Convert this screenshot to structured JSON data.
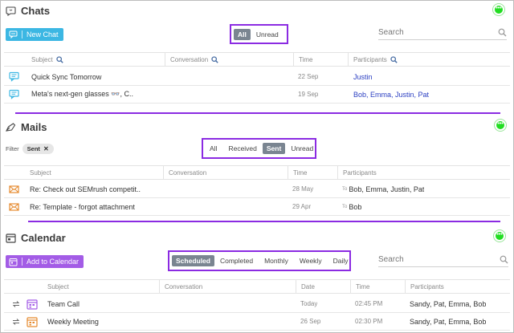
{
  "chats": {
    "title": "Chats",
    "new_button": "New Chat",
    "tabs": [
      "All",
      "Unread"
    ],
    "active_tab": "All",
    "search_placeholder": "Search",
    "columns": [
      "Subject",
      "Conversation",
      "Time",
      "Participants"
    ],
    "rows": [
      {
        "subject": "Quick Sync Tomorrow",
        "conversation": "",
        "time": "22 Sep",
        "participants": "Justin"
      },
      {
        "subject": "Meta's next-gen glasses 👓, C..",
        "conversation": "",
        "time": "19 Sep",
        "participants": "Bob, Emma, Justin, Pat"
      }
    ]
  },
  "mails": {
    "title": "Mails",
    "filter_label": "Filter",
    "filter_chip": "Sent",
    "tabs": [
      "All",
      "Received",
      "Sent",
      "Unread"
    ],
    "active_tab": "Sent",
    "columns": [
      "Subject",
      "Conversation",
      "Time",
      "Participants"
    ],
    "rows": [
      {
        "subject": "Re: Check out SEMrush competit..",
        "conversation": "",
        "time": "28 May",
        "to": "To",
        "participants": "Bob, Emma, Justin, Pat"
      },
      {
        "subject": "Re: Template - forgot attachment",
        "conversation": "",
        "time": "29 Apr",
        "to": "To",
        "participants": "Bob"
      }
    ]
  },
  "calendar": {
    "title": "Calendar",
    "add_button": "Add to Calendar",
    "tabs": [
      "Scheduled",
      "Completed",
      "Monthly",
      "Weekly",
      "Daily"
    ],
    "active_tab": "Scheduled",
    "search_placeholder": "Search",
    "columns": [
      "Subject",
      "Conversation",
      "Date",
      "Time",
      "Participants"
    ],
    "rows": [
      {
        "subject": "Team Call",
        "conversation": "",
        "date": "Today",
        "time": "02:45 PM",
        "participants": "Sandy, Pat, Emma, Bob"
      },
      {
        "subject": "Weekly Meeting",
        "conversation": "",
        "date": "26 Sep",
        "time": "02:30 PM",
        "participants": "Sandy, Pat, Emma, Bob"
      }
    ]
  },
  "colors": {
    "accent_purple": "#8b2be2",
    "chat_blue": "#3cb7e3",
    "calendar_purple": "#a35ce6",
    "link_blue": "#2b3fc2",
    "status_green": "#22dd22",
    "mail_orange": "#e58a2e"
  }
}
